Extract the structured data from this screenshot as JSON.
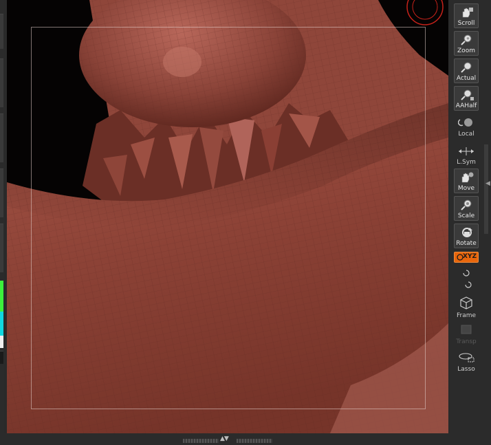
{
  "toolbar": {
    "buttons": [
      {
        "label": "Scroll",
        "icon": "hand-scroll-icon"
      },
      {
        "label": "Zoom",
        "icon": "magnifier-zoom-icon"
      },
      {
        "label": "Actual",
        "icon": "magnifier-actual-icon"
      },
      {
        "label": "AAHalf",
        "icon": "magnifier-aahalf-icon"
      },
      {
        "label": "Local",
        "icon": "local-sphere-icon"
      },
      {
        "label": "L.Sym",
        "icon": "local-symmetry-icon"
      },
      {
        "label": "Move",
        "icon": "hand-move-icon"
      },
      {
        "label": "Scale",
        "icon": "magnifier-scale-icon"
      },
      {
        "label": "Rotate",
        "icon": "rotate-icon"
      },
      {
        "label": "XYZ",
        "icon": "xyz-rotate-icon"
      },
      {
        "label": "Frame",
        "icon": "cube-frame-icon"
      },
      {
        "label": "Transp",
        "icon": "transparency-icon"
      },
      {
        "label": "Lasso",
        "icon": "lasso-icon"
      }
    ]
  },
  "colors": {
    "accent_orange": "#e8660c",
    "mesh": "#7a3a30",
    "panel": "#2b2b2b",
    "viewport_bg": "#050303"
  }
}
